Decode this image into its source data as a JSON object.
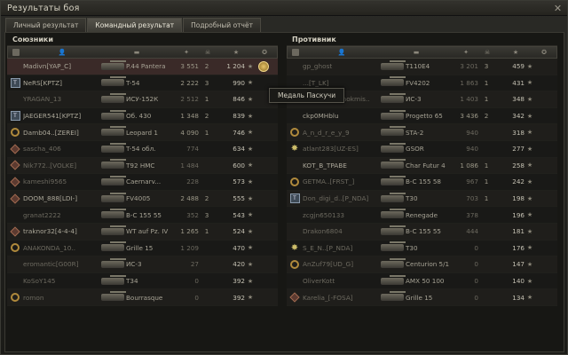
{
  "window": {
    "title": "Результаты боя"
  },
  "tabs": [
    {
      "label": "Личный результат",
      "active": false
    },
    {
      "label": "Командный результат",
      "active": true
    },
    {
      "label": "Подробный отчёт",
      "active": false
    }
  ],
  "tooltip": {
    "text": "Медаль Паскучи"
  },
  "allies": {
    "title": "Союзники",
    "rows": [
      {
        "badge": "none",
        "name": "Madivn[YAP_C]",
        "vehicle": "P.44 Pantera",
        "damage": "3 551",
        "kills": "2",
        "xp": "1 204",
        "medal": true
      },
      {
        "badge": "rank",
        "name": "NeRS[KPTZ]",
        "vehicle": "T-54",
        "damage": "2 222",
        "kills": "3",
        "xp": "990",
        "medal": false
      },
      {
        "badge": "none",
        "name": "YRAGAN_13",
        "vehicle": "ИСУ-152К",
        "damage": "2 512",
        "kills": "1",
        "xp": "846",
        "medal": false,
        "dim": true
      },
      {
        "badge": "rank",
        "name": "JAEGER541[KPTZ]",
        "vehicle": "Об. 430",
        "damage": "1 348",
        "kills": "2",
        "xp": "839",
        "medal": false
      },
      {
        "badge": "ring",
        "name": "Damb04..[ZEREI]",
        "vehicle": "Leopard 1",
        "damage": "4 090",
        "kills": "1",
        "xp": "746",
        "medal": false
      },
      {
        "badge": "dia",
        "name": "sascha_406",
        "vehicle": "T-54 обл.",
        "damage": "774",
        "kills": "",
        "xp": "634",
        "medal": false,
        "dim": true
      },
      {
        "badge": "dia",
        "name": "Nik772..[VOLKE]",
        "vehicle": "T92 HMC",
        "damage": "1 484",
        "kills": "",
        "xp": "600",
        "medal": false,
        "dim": true
      },
      {
        "badge": "dia",
        "name": "kameshi9565",
        "vehicle": "Caernarv...",
        "damage": "228",
        "kills": "",
        "xp": "573",
        "medal": false,
        "dim": true
      },
      {
        "badge": "dia",
        "name": "DOOM_888[LDI-]",
        "vehicle": "FV4005",
        "damage": "2 488",
        "kills": "2",
        "xp": "555",
        "medal": false
      },
      {
        "badge": "none",
        "name": "granat2222",
        "vehicle": "B-C 155 55",
        "damage": "352",
        "kills": "3",
        "xp": "543",
        "medal": false,
        "dim": true
      },
      {
        "badge": "dia",
        "name": "traknor32[4-4-4]",
        "vehicle": "WT auf Pz. IV",
        "damage": "1 265",
        "kills": "1",
        "xp": "524",
        "medal": false
      },
      {
        "badge": "ring",
        "name": "ANAKONDA_10..",
        "vehicle": "Grille 15",
        "damage": "1 209",
        "kills": "",
        "xp": "470",
        "medal": false,
        "dim": true
      },
      {
        "badge": "none",
        "name": "eromantic[G00R]",
        "vehicle": "ИС-3",
        "damage": "27",
        "kills": "",
        "xp": "420",
        "medal": false,
        "dim": true
      },
      {
        "badge": "none",
        "name": "KoSoY145",
        "vehicle": "T34",
        "damage": "0",
        "kills": "",
        "xp": "392",
        "medal": false,
        "dim": true
      },
      {
        "badge": "ring",
        "name": "romon",
        "vehicle": "Bourrasque",
        "damage": "0",
        "kills": "",
        "xp": "392",
        "medal": false,
        "dim": true
      }
    ]
  },
  "enemies": {
    "title": "Противник",
    "rows": [
      {
        "badge": "none",
        "name": "gp_ghost",
        "vehicle": "T110E4",
        "damage": "3 201",
        "kills": "3",
        "xp": "459",
        "dim": true
      },
      {
        "badge": "none",
        "name": "...[T_LK]",
        "vehicle": "FV4202",
        "damage": "1 863",
        "kills": "1",
        "xp": "431",
        "dim": true
      },
      {
        "badge": "none",
        "name": "korea_Sprilenokmis..",
        "vehicle": "ИС-3",
        "damage": "1 403",
        "kills": "1",
        "xp": "348",
        "dim": true
      },
      {
        "badge": "none",
        "name": "ckp0MHblu",
        "vehicle": "Progetto 65",
        "damage": "3 436",
        "kills": "2",
        "xp": "342"
      },
      {
        "badge": "ring",
        "name": "A_n_d_r_e_y_9",
        "vehicle": "STA-2",
        "damage": "940",
        "kills": "",
        "xp": "318",
        "dim": true
      },
      {
        "badge": "star",
        "name": "atlant283[UZ-ES]",
        "vehicle": "GSOR",
        "damage": "940",
        "kills": "",
        "xp": "277",
        "dim": true
      },
      {
        "badge": "none",
        "name": "KOT_B_TPABE",
        "vehicle": "Char Futur 4",
        "damage": "1 086",
        "kills": "1",
        "xp": "258"
      },
      {
        "badge": "ring",
        "name": "GETMA..[FRST_]",
        "vehicle": "B-C 155 58",
        "damage": "967",
        "kills": "1",
        "xp": "242",
        "dim": true
      },
      {
        "badge": "rank",
        "name": "Don_digi_d..[P_NDA]",
        "vehicle": "T30",
        "damage": "703",
        "kills": "1",
        "xp": "198",
        "dim": true
      },
      {
        "badge": "none",
        "name": "zcgjn650133",
        "vehicle": "Renegade",
        "damage": "378",
        "kills": "",
        "xp": "196",
        "dim": true
      },
      {
        "badge": "none",
        "name": "Drakon6804",
        "vehicle": "B-C 155 55",
        "damage": "444",
        "kills": "",
        "xp": "181",
        "dim": true
      },
      {
        "badge": "star",
        "name": "S_E_N..[P_NDA]",
        "vehicle": "T30",
        "damage": "0",
        "kills": "",
        "xp": "176",
        "dim": true
      },
      {
        "badge": "ring",
        "name": "AnZuf79[UD_G]",
        "vehicle": "Centurion 5/1",
        "damage": "0",
        "kills": "",
        "xp": "147",
        "dim": true
      },
      {
        "badge": "none",
        "name": "OliverKott",
        "vehicle": "AMX 50 100",
        "damage": "0",
        "kills": "",
        "xp": "140",
        "dim": true
      },
      {
        "badge": "dia",
        "name": "Karelia_[-FOSA]",
        "vehicle": "Grille 15",
        "damage": "0",
        "kills": "",
        "xp": "134",
        "dim": true
      }
    ]
  }
}
